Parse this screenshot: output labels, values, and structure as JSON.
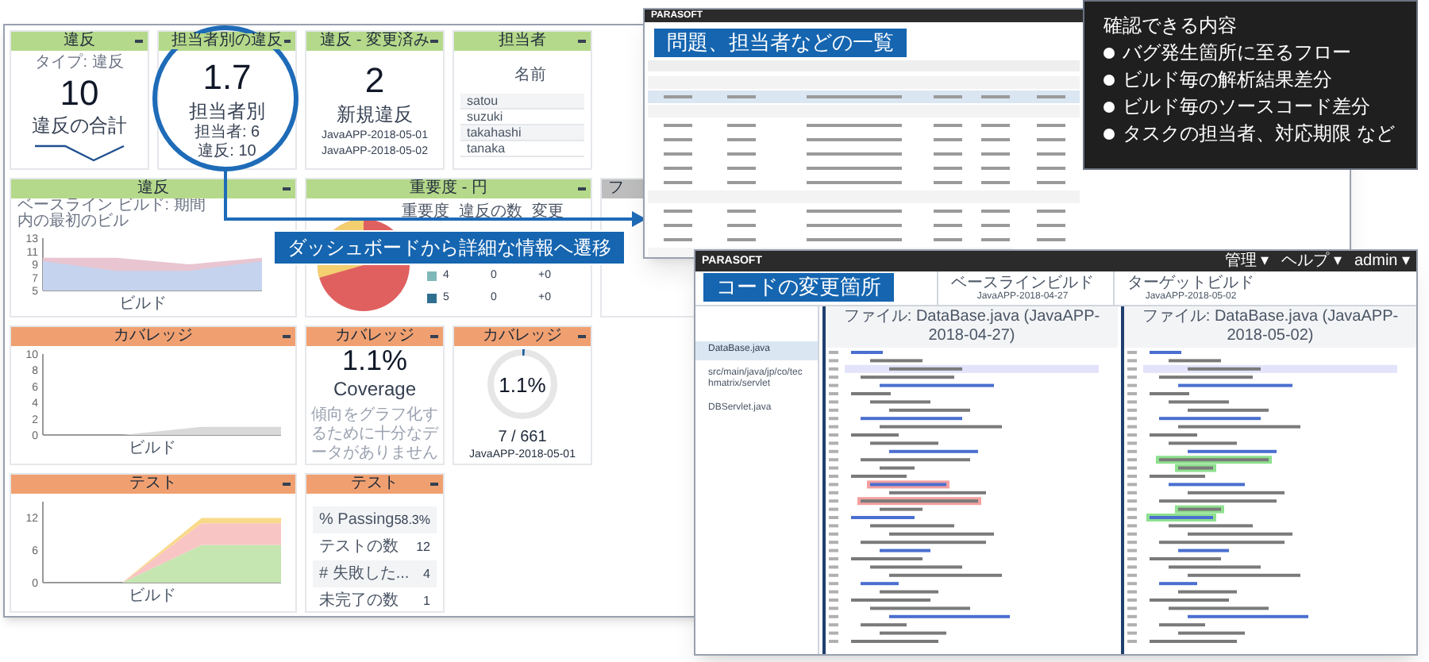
{
  "dashboard": {
    "widgets": [
      {
        "kind": "metric",
        "title": "違反",
        "color": "#b5d98a",
        "subtitle": "タイプ: 違反",
        "value": "10",
        "label": "違反の合計",
        "sparkline": true
      },
      {
        "kind": "metric",
        "title": "担当者別の違反",
        "color": "#b5d98a",
        "value": "1.7",
        "label": "担当者別",
        "notes": [
          "担当者: 6",
          "違反: 10"
        ]
      },
      {
        "kind": "metric",
        "title": "違反 - 変更済み",
        "color": "#b5d98a",
        "value": "2",
        "label": "新規違反",
        "dates": [
          "JavaAPP-2018-05-01",
          "JavaAPP-2018-05-02"
        ]
      },
      {
        "kind": "list",
        "title": "担当者",
        "color": "#b5d98a",
        "column": "名前",
        "items": [
          "satou",
          "suzuki",
          "takahashi",
          "tanaka"
        ]
      },
      {
        "kind": "chart",
        "title": "違反",
        "color": "#b5d98a",
        "subtitle": "ベースライン ビルド: 期間内の最初のビル",
        "chart_data": {
          "type": "area",
          "xlabel": "ビルド",
          "categories": [
            null,
            null,
            null,
            null
          ],
          "ylim": [
            5,
            13
          ],
          "yticks": [
            5,
            7,
            9,
            11,
            13
          ],
          "stacked": false,
          "series": [
            {
              "color": "#e8c5d0",
              "values": [
                10,
                10,
                9,
                10
              ]
            },
            {
              "color": "#c5d3ee",
              "values": [
                9.5,
                8,
                8,
                9.5
              ]
            }
          ]
        }
      },
      {
        "kind": "pie",
        "title": "重要度 - 円",
        "color": "#b5d98a",
        "columns": [
          "重要度",
          "違反の数",
          "変更"
        ],
        "rows": [
          {
            "color": "#7fb8b8",
            "cells": [
              "4",
              "0",
              "+0"
            ]
          },
          {
            "color": "#2f6f8f",
            "cells": [
              "5",
              "0",
              "+0"
            ]
          }
        ]
      },
      {
        "kind": "stub",
        "title": "フ",
        "color": "#bdbdbd"
      },
      {
        "kind": "chart",
        "title": "カバレッジ",
        "color": "#f0a070",
        "chart_data": {
          "type": "area",
          "xlabel": "ビルド",
          "categories": [
            null,
            null,
            null,
            null
          ],
          "ylim": [
            0,
            10
          ],
          "yticks": [
            0,
            2,
            4,
            6,
            8,
            10
          ],
          "stacked": false,
          "series": [
            {
              "color": "#d9d9d9",
              "values": [
                0,
                0,
                1,
                1
              ]
            }
          ]
        }
      },
      {
        "kind": "metric",
        "title": "カバレッジ",
        "color": "#f0a070",
        "value": "1.1%",
        "label": "Coverage",
        "message": "傾向をグラフ化するために十分なデータがありません"
      },
      {
        "kind": "ring",
        "title": "カバレッジ",
        "color": "#f0a070",
        "value": "1.1%",
        "level": 0.011,
        "count": "7 / 661",
        "date": "JavaAPP-2018-05-01"
      },
      {
        "kind": "chart",
        "title": "テスト",
        "color": "#f0a070",
        "chart_data": {
          "type": "area",
          "xlabel": "ビルド",
          "categories": [
            null,
            null,
            null,
            null
          ],
          "ylim": [
            0,
            15
          ],
          "yticks": [
            0,
            6,
            12
          ],
          "stacked": true,
          "series": [
            {
              "color": "#c5e6b0",
              "values": [
                0,
                0,
                7,
                7
              ]
            },
            {
              "color": "#f9c4c4",
              "values": [
                0,
                0,
                4,
                4
              ]
            },
            {
              "color": "#f9d98a",
              "values": [
                0,
                0,
                1,
                1
              ]
            }
          ]
        }
      },
      {
        "kind": "table",
        "title": "テスト",
        "color": "#f0a070",
        "rows": [
          [
            "% Passing",
            "58.3%"
          ],
          [
            "テストの数",
            "12"
          ],
          [
            "# 失敗した...",
            "4"
          ],
          [
            "未完了の数",
            "1"
          ]
        ]
      }
    ]
  },
  "callouts": [
    {
      "text": "ダッシュボードから詳細な情報へ遷移"
    },
    {
      "text": "問題、担当者などの一覧"
    },
    {
      "text": "コードの変更箇所"
    }
  ],
  "info_box": {
    "title": "確認できる内容",
    "bullets": [
      "バグ発生箇所に至るフロー",
      "ビルド毎の解析結果差分",
      "ビルド毎のソースコード差分",
      "タスクの担当者、対応期限 など"
    ]
  },
  "issues_window": {
    "logo": "PARASOFT"
  },
  "code_window": {
    "logo": "PARASOFT",
    "menu": [
      "管理 ▾",
      "ヘルプ ▾",
      "admin ▾"
    ],
    "tabs": [
      {
        "label": "ベースラインビルド",
        "sub": "JavaAPP-2018-04-27",
        "selected": false
      },
      {
        "label": "ターゲットビルド",
        "sub": "JavaAPP-2018-05-02",
        "selected": false
      }
    ],
    "tree": [
      {
        "label": "DataBase.java",
        "selected": true
      },
      {
        "label": "src/main/java/jp/co/techmatrix/servlet",
        "selected": false
      },
      {
        "label": "DBServlet.java",
        "selected": false
      }
    ],
    "panes": [
      {
        "file": "ファイル: DataBase.java (JavaAPP-2018-04-27)"
      },
      {
        "file": "ファイル: DataBase.java (JavaAPP-2018-05-02)"
      }
    ]
  }
}
